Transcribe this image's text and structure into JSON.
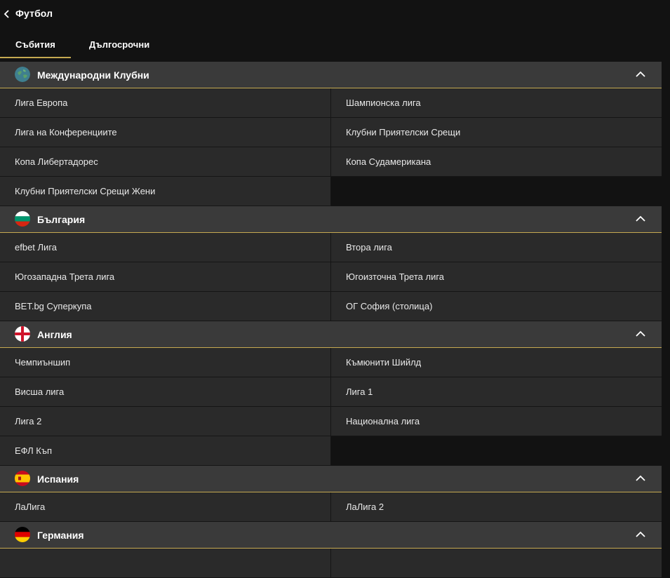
{
  "header": {
    "title": "Футбол"
  },
  "tabs": [
    {
      "label": "Събития"
    },
    {
      "label": "Дългосрочни"
    }
  ],
  "colors": {
    "accent": "#c5a951",
    "header_bg": "#3a3a3a",
    "cell_bg": "#2a2a2a",
    "page_bg": "#121212"
  },
  "groups": [
    {
      "title": "Международни Клубни",
      "icon": "globe-icon",
      "items": [
        "Лига Европа",
        "Шампионска лига",
        "Лига на Конференциите",
        "Клубни Приятелски Срещи",
        "Копа Либертадорес",
        "Копа Судамерикана",
        "Клубни Приятелски Срещи Жени"
      ]
    },
    {
      "title": "България",
      "icon": "bulgaria-flag-icon",
      "items": [
        "efbet Лига",
        "Втора лига",
        "Югозападна Трета лига",
        "Югоизточна Трета лига",
        "BET.bg Суперкупа",
        "ОГ София (столица)"
      ]
    },
    {
      "title": "Англия",
      "icon": "england-flag-icon",
      "items": [
        "Чемпиъншип",
        "Къмюнити Шийлд",
        "Висша лига",
        "Лига 1",
        "Лига 2",
        "Национална лига",
        "ЕФЛ Къп"
      ]
    },
    {
      "title": "Испания",
      "icon": "spain-flag-icon",
      "items": [
        "ЛаЛига",
        "ЛаЛига 2"
      ]
    },
    {
      "title": "Германия",
      "icon": "germany-flag-icon",
      "items": []
    }
  ]
}
